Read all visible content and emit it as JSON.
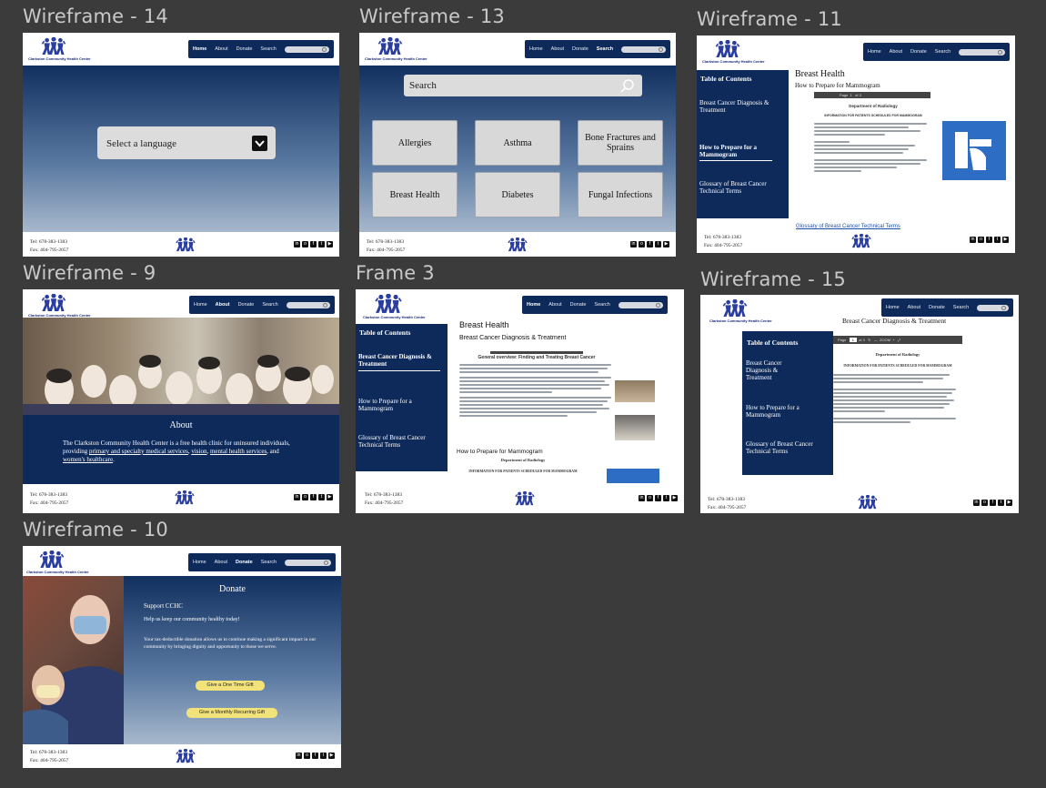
{
  "frames": {
    "w14": {
      "title": "Wireframe - 14",
      "select_label": "Select a language"
    },
    "w13": {
      "title": "Wireframe - 13",
      "search_placeholder": "Search",
      "tiles": [
        "Allergies",
        "Asthma",
        "Bone Fractures and Sprains",
        "Breast Health",
        "Diabetes",
        "Fungal Infections"
      ]
    },
    "w11": {
      "title": "Wireframe - 11",
      "heading": "Breast Health",
      "subheading": "How to Prepare for Mammogram",
      "link": "Glossary of Breast Cancer Technical Terms"
    },
    "w9": {
      "title": "Wireframe - 9",
      "about_heading": "About",
      "about_p1": "The Clarkston Community Health Center is a free health clinic for uninsured individuals, providing ",
      "link1": "primary and specialty medical services",
      "sep1": ", ",
      "link2": "vision",
      "sep2": ", ",
      "link3": "mental health services",
      "sep3": ", and ",
      "link4": "women's healthcare",
      "end": "."
    },
    "f3": {
      "title": "Frame 3",
      "heading": "Breast Health",
      "subheading": "Breast Cancer Diagnosis & Treatment",
      "doc_title": "General overview: Finding and Treating Breast Cancer",
      "section2": "How to Prepare for Mammogram",
      "dept": "Department of Radiology",
      "info": "INFORMATION FOR PATIENTS SCHEDULED FOR MAMMOGRAM"
    },
    "w15": {
      "title": "Wireframe - 15",
      "heading": "Breast Cancer Diagnosis & Treatment",
      "dept": "Department of Radiology",
      "info": "INFORMATION FOR PATIENTS SCHEDULED FOR MAMMOGRAM"
    },
    "w10": {
      "title": "Wireframe - 10",
      "donate_heading": "Donate",
      "support": "Support CCHC",
      "keep": "Help us keep our community healthy today!",
      "body": "Your tax-deductible donation allows us to continue making a significant impact in our community by bringing dignity and opportunity to those we serve.",
      "btn1": "Give a One Time Gift",
      "btn2": "Give a Monthly Recurring Gift"
    }
  },
  "nav": {
    "home": "Home",
    "about": "About",
    "donate": "Donate",
    "search": "Search"
  },
  "logo_text": "Clarkston Community Health Center",
  "toc": {
    "heading": "Table of Contents",
    "item1": "Breast Cancer Diagnosis & Treatment",
    "item2": "How to Prepare for a Mammogram",
    "item3": "Glossary of Breast Cancer Technical Terms"
  },
  "footer": {
    "tel": "Tel: 678-383-1383",
    "fax": "Fax: 404-795-2057"
  },
  "pdf": {
    "page": "Page",
    "of": "of 3",
    "zoom": "ZOOM"
  },
  "colors": {
    "navy": "#0d2a5a",
    "gold": "#f2e27a",
    "link": "#1b4fa8"
  }
}
